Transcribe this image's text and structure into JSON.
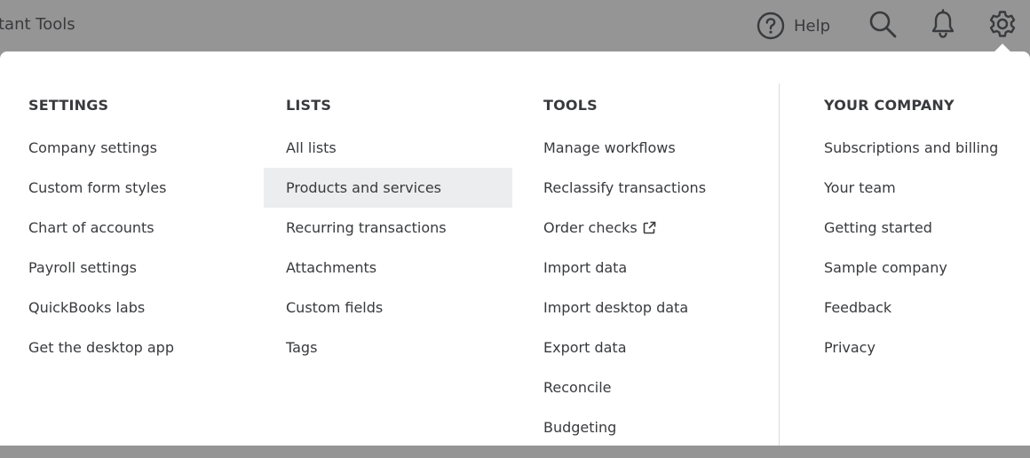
{
  "topbar": {
    "title": "tant Tools",
    "help_label": "Help",
    "icons": [
      "help-circle-icon",
      "search-icon",
      "bell-icon",
      "gear-icon"
    ]
  },
  "columns": [
    {
      "header": "SETTINGS",
      "items": [
        {
          "label": "Company settings"
        },
        {
          "label": "Custom form styles"
        },
        {
          "label": "Chart of accounts"
        },
        {
          "label": "Payroll settings"
        },
        {
          "label": "QuickBooks labs"
        },
        {
          "label": "Get the desktop app"
        }
      ]
    },
    {
      "header": "LISTS",
      "items": [
        {
          "label": "All lists"
        },
        {
          "label": "Products and services",
          "highlighted": true
        },
        {
          "label": "Recurring transactions"
        },
        {
          "label": "Attachments"
        },
        {
          "label": "Custom fields"
        },
        {
          "label": "Tags"
        }
      ]
    },
    {
      "header": "TOOLS",
      "items": [
        {
          "label": "Manage workflows"
        },
        {
          "label": "Reclassify transactions"
        },
        {
          "label": "Order checks",
          "icon": "external-link-icon"
        },
        {
          "label": "Import data"
        },
        {
          "label": "Import desktop data"
        },
        {
          "label": "Export data"
        },
        {
          "label": "Reconcile"
        },
        {
          "label": "Budgeting"
        }
      ]
    },
    {
      "header": "YOUR COMPANY",
      "items": [
        {
          "label": "Subscriptions and billing"
        },
        {
          "label": "Your team"
        },
        {
          "label": "Getting started"
        },
        {
          "label": "Sample company"
        },
        {
          "label": "Feedback"
        },
        {
          "label": "Privacy"
        }
      ]
    }
  ],
  "colors": {
    "overlay": "#959595",
    "panel": "#ffffff",
    "text": "#393a3d",
    "highlight": "#ecedef",
    "divider": "#dcdcdc"
  }
}
